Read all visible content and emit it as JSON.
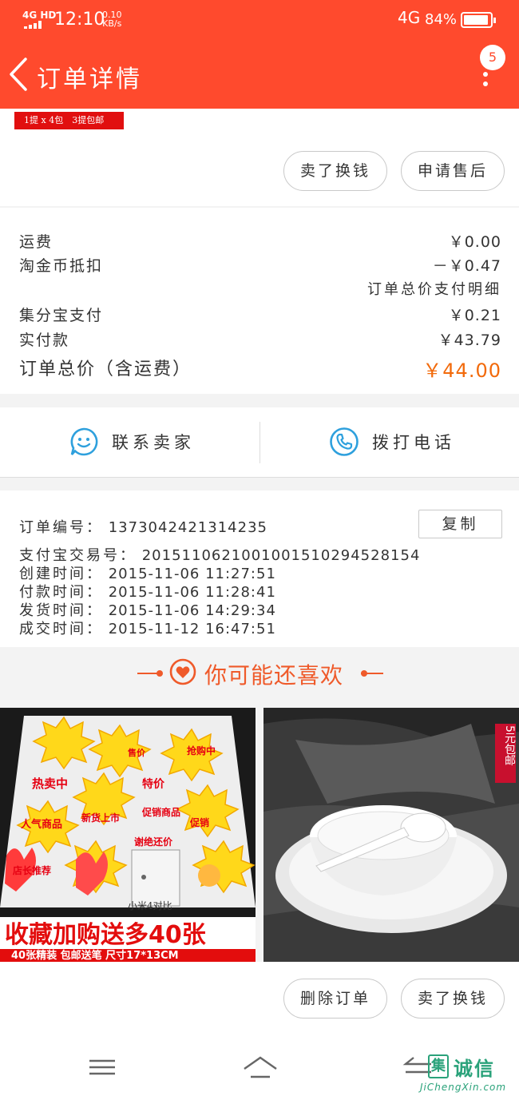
{
  "status_bar": {
    "network_label": "4G HD",
    "time": "12:10",
    "speed_value": "0.10",
    "speed_unit": "KB/s",
    "network": "4G",
    "battery": "84%"
  },
  "header": {
    "title": "订单详情",
    "message_count": "5"
  },
  "product": {
    "promo_tag": "1提 x 4包　3提包邮",
    "sell_button": "卖了换钱",
    "after_sale_button": "申请售后"
  },
  "prices": {
    "shipping_label": "运费",
    "shipping_value": "￥0.00",
    "coin_label": "淘金币抵扣",
    "coin_value": "－￥0.47",
    "detail_link": "订单总价支付明细",
    "jifen_label": "集分宝支付",
    "jifen_value": "￥0.21",
    "paid_label": "实付款",
    "paid_value": "￥43.79",
    "total_label": "订单总价（含运费）",
    "total_value": "￥44.00"
  },
  "contact": {
    "seller_label": "联系卖家",
    "phone_label": "拨打电话"
  },
  "order": {
    "number_label": "订单编号：",
    "number_value": "1373042421314235",
    "copy_button": "复制",
    "alipay_label": "支付宝交易号：",
    "alipay_value": "2015110621001001510294528154",
    "created_label": "创建时间：",
    "created_value": "2015-11-06 11:27:51",
    "paid_label": "付款时间：",
    "paid_value": "2015-11-06 11:28:41",
    "shipped_label": "发货时间：",
    "shipped_value": "2015-11-06 14:29:34",
    "done_label": "成交时间：",
    "done_value": "2015-11-12 16:47:51"
  },
  "recommend": {
    "title": "你可能还喜欢",
    "left_card_banner": "收藏加购送多40张",
    "left_card_sub": "40张精装 包邮送笔 尺寸17*13CM",
    "left_card_phone": "小米4对比",
    "left_card_stickers": [
      "热卖中",
      "特价",
      "促销商品",
      "新货上市",
      "人气商品",
      "店长推荐",
      "谢绝还价",
      "抢购中",
      "售价",
      "促销"
    ],
    "right_card_tag": "5元包邮"
  },
  "bottom": {
    "delete_button": "删除订单",
    "sell_button": "卖了换钱"
  },
  "watermark": {
    "char": "集",
    "brand": "诚信",
    "url": "JiChengXin.com"
  },
  "colors": {
    "header_bg": "#ff4a2d",
    "accent": "#f26a0b",
    "blue_icon": "#2ea0dd"
  }
}
